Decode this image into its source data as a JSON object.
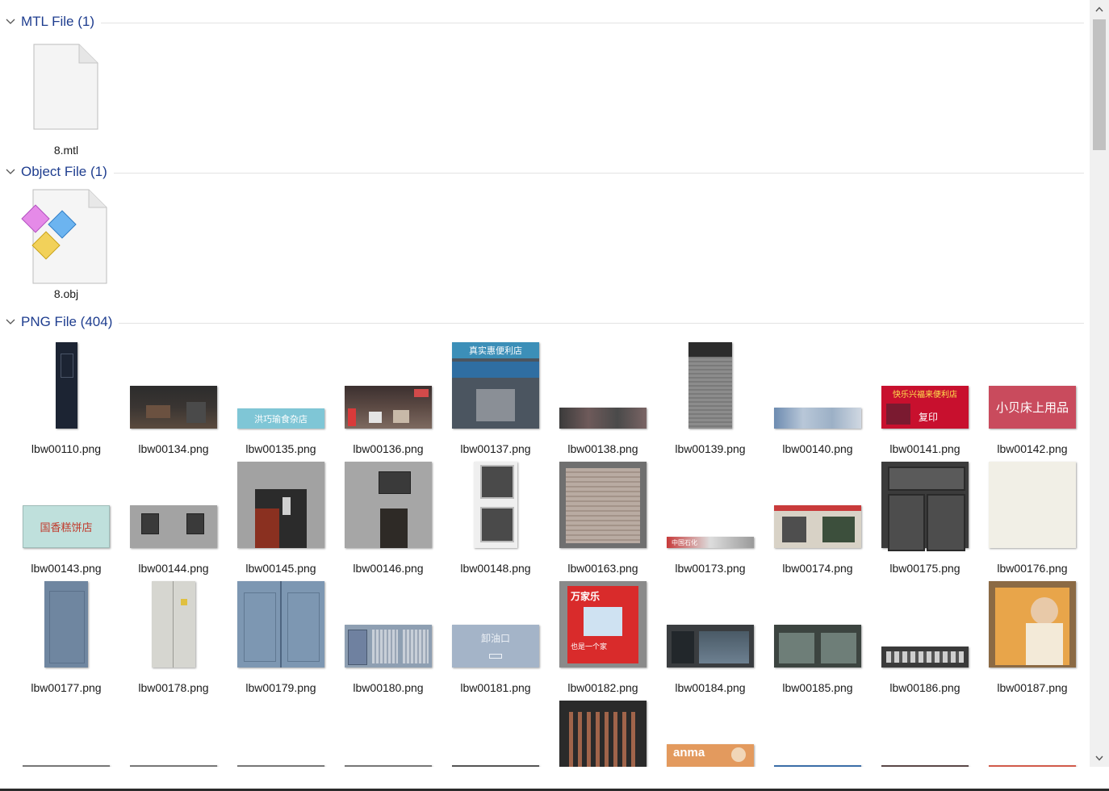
{
  "groups": [
    {
      "title": "MTL File (1)",
      "files": [
        {
          "name": "8.mtl",
          "icon": "document-icon"
        }
      ]
    },
    {
      "title": "Object File (1)",
      "files": [
        {
          "name": "8.obj",
          "icon": "3d-object-icon"
        }
      ]
    },
    {
      "title": "PNG File (404)",
      "files": [
        "lbw00110.png",
        "lbw00134.png",
        "lbw00135.png",
        "lbw00136.png",
        "lbw00137.png",
        "lbw00138.png",
        "lbw00139.png",
        "lbw00140.png",
        "lbw00141.png",
        "lbw00142.png",
        "lbw00143.png",
        "lbw00144.png",
        "lbw00145.png",
        "lbw00146.png",
        "lbw00148.png",
        "lbw00163.png",
        "lbw00173.png",
        "lbw00174.png",
        "lbw00175.png",
        "lbw00176.png",
        "lbw00177.png",
        "lbw00178.png",
        "lbw00179.png",
        "lbw00180.png",
        "lbw00181.png",
        "lbw00182.png",
        "lbw00184.png",
        "lbw00185.png",
        "lbw00186.png",
        "lbw00187.png"
      ]
    }
  ],
  "thumb_text": {
    "t135": "洪巧瑜食杂店",
    "t137": "真实惠便利店",
    "t141": "快乐兴福来便利店",
    "t141b": "复印",
    "t142": "小贝床上用品",
    "t143": "国香糕饼店",
    "t181": "卸油口",
    "t182": "万家乐",
    "t182b": "也是一个家",
    "t173": "中国石化",
    "t_anma": "anma"
  },
  "colors": {
    "header_text": "#1e3d8f",
    "divider": "#e3e3e3",
    "scrollbar_track": "#f0f0f0",
    "scrollbar_thumb": "#c1c1c1"
  },
  "scrollbar": {
    "up_icon": "chevron-up-icon",
    "down_icon": "chevron-down-icon"
  }
}
